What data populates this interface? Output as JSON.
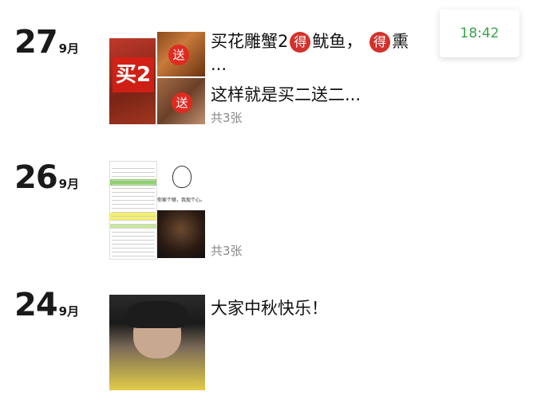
{
  "status": {
    "time": "18:42",
    "time_color": "#3aa34a"
  },
  "entries": [
    {
      "day": "27",
      "month": "9月",
      "line1_a": "买花雕蟹2",
      "badge": "得",
      "line1_b": "鱿鱼，",
      "line1_c": "熏",
      "line2": "...",
      "line3": "这样就是买二送二...",
      "photo_count": "共3张",
      "thumb_main_text": "买2",
      "thumb_tag": "送"
    },
    {
      "day": "26",
      "month": "9月",
      "photo_count": "共3张",
      "meme_caption": "你家个够，我现个心。"
    },
    {
      "day": "24",
      "month": "9月",
      "text": "大家中秋快乐！"
    }
  ]
}
